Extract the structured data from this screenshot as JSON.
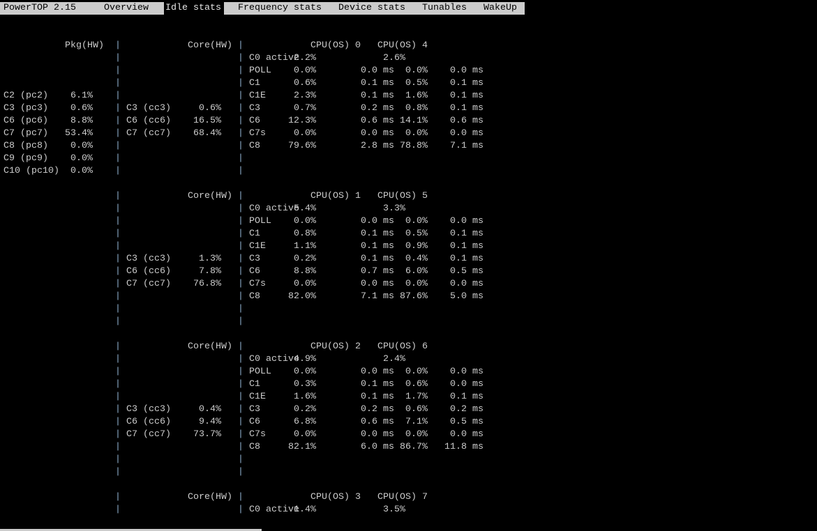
{
  "header": {
    "app_title": "PowerTOP 2.15",
    "tabs": [
      {
        "label": "Overview",
        "selected": false
      },
      {
        "label": "Idle stats",
        "selected": true
      },
      {
        "label": "Frequency stats",
        "selected": false
      },
      {
        "label": "Device stats",
        "selected": false
      },
      {
        "label": "Tunables",
        "selected": false
      },
      {
        "label": "WakeUp",
        "selected": false
      }
    ]
  },
  "colors": {
    "text": "#cccccc",
    "separator": "#8fb0cf",
    "tabbar": "#cccccc"
  },
  "package": {
    "title": "Pkg(HW)",
    "states": [
      {
        "name": "C2 (pc2)",
        "pct": "6.1%"
      },
      {
        "name": "C3 (pc3)",
        "pct": "0.6%"
      },
      {
        "name": "C6 (pc6)",
        "pct": "8.8%"
      },
      {
        "name": "C7 (pc7)",
        "pct": "53.4%"
      },
      {
        "name": "C8 (pc8)",
        "pct": "0.0%"
      },
      {
        "name": "C9 (pc9)",
        "pct": "0.0%"
      },
      {
        "name": "C10 (pc10)",
        "pct": "0.0%"
      }
    ]
  },
  "cores": [
    {
      "title": "Core(HW)",
      "states": [
        {
          "name": "C3 (cc3)",
          "pct": "0.6%"
        },
        {
          "name": "C6 (cc6)",
          "pct": "16.5%"
        },
        {
          "name": "C7 (cc7)",
          "pct": "68.4%"
        }
      ],
      "cpu_a": "CPU(OS) 0",
      "cpu_b": "CPU(OS) 4",
      "c0": {
        "name": "C0 active",
        "a": "2.2%",
        "b": "2.6%"
      },
      "rows": [
        {
          "name": "POLL",
          "a_pct": "0.0%",
          "a_time": "0.0",
          "b_pct": "0.0%",
          "b_time": "0.0"
        },
        {
          "name": "C1",
          "a_pct": "0.6%",
          "a_time": "0.1",
          "b_pct": "0.5%",
          "b_time": "0.1"
        },
        {
          "name": "C1E",
          "a_pct": "2.3%",
          "a_time": "0.1",
          "b_pct": "1.6%",
          "b_time": "0.1"
        },
        {
          "name": "C3",
          "a_pct": "0.7%",
          "a_time": "0.2",
          "b_pct": "0.8%",
          "b_time": "0.1"
        },
        {
          "name": "C6",
          "a_pct": "12.3%",
          "a_time": "0.6",
          "b_pct": "14.1%",
          "b_time": "0.6"
        },
        {
          "name": "C7s",
          "a_pct": "0.0%",
          "a_time": "0.0",
          "b_pct": "0.0%",
          "b_time": "0.0"
        },
        {
          "name": "C8",
          "a_pct": "79.6%",
          "a_time": "2.8",
          "b_pct": "78.8%",
          "b_time": "7.1"
        }
      ]
    },
    {
      "title": "Core(HW)",
      "states": [
        {
          "name": "C3 (cc3)",
          "pct": "1.3%"
        },
        {
          "name": "C6 (cc6)",
          "pct": "7.8%"
        },
        {
          "name": "C7 (cc7)",
          "pct": "76.8%"
        }
      ],
      "cpu_a": "CPU(OS) 1",
      "cpu_b": "CPU(OS) 5",
      "c0": {
        "name": "C0 active",
        "a": "5.4%",
        "b": "3.3%"
      },
      "rows": [
        {
          "name": "POLL",
          "a_pct": "0.0%",
          "a_time": "0.0",
          "b_pct": "0.0%",
          "b_time": "0.0"
        },
        {
          "name": "C1",
          "a_pct": "0.8%",
          "a_time": "0.1",
          "b_pct": "0.5%",
          "b_time": "0.1"
        },
        {
          "name": "C1E",
          "a_pct": "1.1%",
          "a_time": "0.1",
          "b_pct": "0.9%",
          "b_time": "0.1"
        },
        {
          "name": "C3",
          "a_pct": "0.2%",
          "a_time": "0.1",
          "b_pct": "0.4%",
          "b_time": "0.1"
        },
        {
          "name": "C6",
          "a_pct": "8.8%",
          "a_time": "0.7",
          "b_pct": "6.0%",
          "b_time": "0.5"
        },
        {
          "name": "C7s",
          "a_pct": "0.0%",
          "a_time": "0.0",
          "b_pct": "0.0%",
          "b_time": "0.0"
        },
        {
          "name": "C8",
          "a_pct": "82.0%",
          "a_time": "7.1",
          "b_pct": "87.6%",
          "b_time": "5.0"
        }
      ]
    },
    {
      "title": "Core(HW)",
      "states": [
        {
          "name": "C3 (cc3)",
          "pct": "0.4%"
        },
        {
          "name": "C6 (cc6)",
          "pct": "9.4%"
        },
        {
          "name": "C7 (cc7)",
          "pct": "73.7%"
        }
      ],
      "cpu_a": "CPU(OS) 2",
      "cpu_b": "CPU(OS) 6",
      "c0": {
        "name": "C0 active",
        "a": "4.9%",
        "b": "2.4%"
      },
      "rows": [
        {
          "name": "POLL",
          "a_pct": "0.0%",
          "a_time": "0.0",
          "b_pct": "0.0%",
          "b_time": "0.0"
        },
        {
          "name": "C1",
          "a_pct": "0.3%",
          "a_time": "0.1",
          "b_pct": "0.6%",
          "b_time": "0.0"
        },
        {
          "name": "C1E",
          "a_pct": "1.6%",
          "a_time": "0.1",
          "b_pct": "1.7%",
          "b_time": "0.1"
        },
        {
          "name": "C3",
          "a_pct": "0.2%",
          "a_time": "0.2",
          "b_pct": "0.6%",
          "b_time": "0.2"
        },
        {
          "name": "C6",
          "a_pct": "6.8%",
          "a_time": "0.6",
          "b_pct": "7.1%",
          "b_time": "0.5"
        },
        {
          "name": "C7s",
          "a_pct": "0.0%",
          "a_time": "0.0",
          "b_pct": "0.0%",
          "b_time": "0.0"
        },
        {
          "name": "C8",
          "a_pct": "82.1%",
          "a_time": "6.0",
          "b_pct": "86.7%",
          "b_time": "11.8"
        }
      ]
    },
    {
      "title": "Core(HW)",
      "states": [],
      "cpu_a": "CPU(OS) 3",
      "cpu_b": "CPU(OS) 7",
      "c0": {
        "name": "C0 active",
        "a": "1.4%",
        "b": "3.5%"
      },
      "rows": []
    }
  ],
  "time_unit": "ms",
  "separator_glyph": "|"
}
